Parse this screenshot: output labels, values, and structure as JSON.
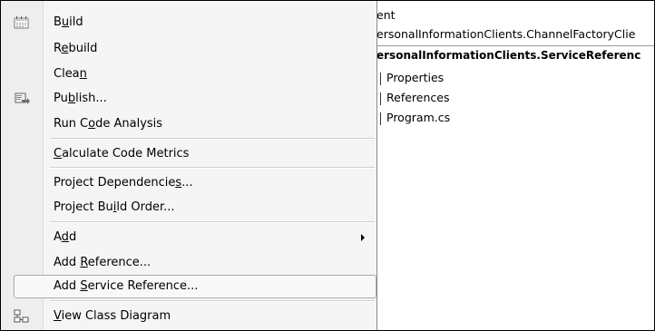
{
  "explorer": {
    "title_fragment": "ent",
    "project_fragment": "ersonalInformationClients.ChannelFactoryClie",
    "selected_project_fragment": "ersonalInformationClients.ServiceReferenc",
    "children": [
      "Properties",
      "References",
      "Program.cs"
    ]
  },
  "menu": {
    "items": [
      {
        "pre": "B",
        "mnemonic": "u",
        "post": "ild",
        "icon": "build-icon"
      },
      {
        "pre": "R",
        "mnemonic": "e",
        "post": "build"
      },
      {
        "pre": "Clea",
        "mnemonic": "n",
        "post": ""
      },
      {
        "pre": "Pu",
        "mnemonic": "b",
        "post": "lish...",
        "icon": "publish-icon"
      },
      {
        "pre": "Run C",
        "mnemonic": "o",
        "post": "de Analysis"
      },
      {
        "pre": "",
        "mnemonic": "C",
        "post": "alculate Code Metrics"
      },
      {
        "pre": "Project Dependencie",
        "mnemonic": "s",
        "post": "..."
      },
      {
        "pre": "Project Bu",
        "mnemonic": "i",
        "post": "ld Order..."
      },
      {
        "pre": "A",
        "mnemonic": "d",
        "post": "d",
        "submenu": true
      },
      {
        "pre": "Add ",
        "mnemonic": "R",
        "post": "eference..."
      },
      {
        "pre": "Add ",
        "mnemonic": "S",
        "post": "ervice Reference...",
        "highlighted": true
      },
      {
        "pre": "",
        "mnemonic": "V",
        "post": "iew Class Diagram",
        "icon": "class-diagram-icon"
      }
    ]
  }
}
